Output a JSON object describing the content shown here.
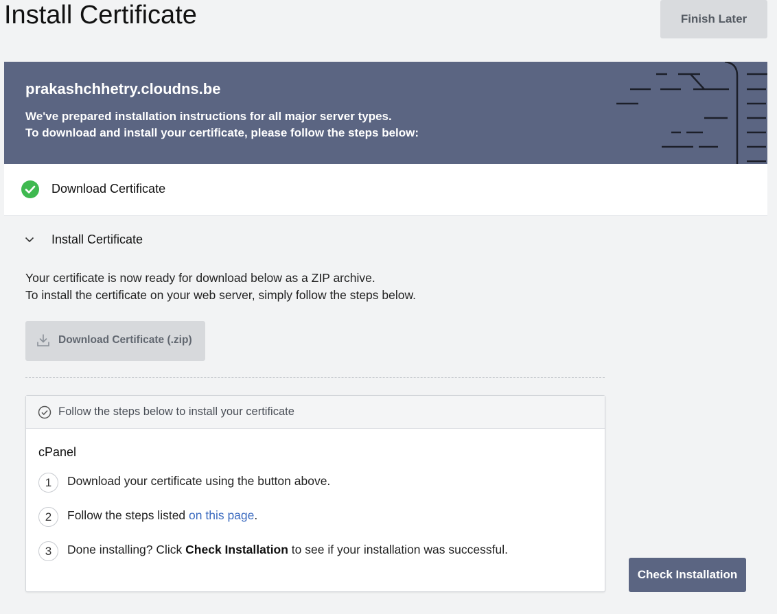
{
  "page": {
    "title": "Install Certificate"
  },
  "header": {
    "finish_later_label": "Finish Later"
  },
  "banner": {
    "domain": "prakashchhetry.cloudns.be",
    "line1": "We've prepared installation instructions for all major server types.",
    "line2": "To download and install your certificate, please follow the steps below:",
    "color": "#5b6582"
  },
  "steps": {
    "download": {
      "label": "Download Certificate",
      "status": "complete",
      "status_color": "#3fb950"
    },
    "install": {
      "label": "Install Certificate",
      "description_line1": "Your certificate is now ready for download below as a ZIP archive.",
      "description_line2": "To install the certificate on your web server, simply follow the steps below.",
      "download_button_label": "Download Certificate (.zip)"
    }
  },
  "instructions": {
    "header": "Follow the steps below to install your certificate",
    "platform": "cPanel",
    "items": [
      {
        "num": "1",
        "text": "Download your certificate using the button above."
      },
      {
        "num": "2",
        "text_before": "Follow the steps listed ",
        "link": "on this page",
        "text_after": "."
      },
      {
        "num": "3",
        "text_before": "Done installing? Click ",
        "bold": "Check Installation",
        "text_after": " to see if your installation was successful."
      }
    ]
  },
  "footer": {
    "check_installation_label": "Check Installation"
  }
}
